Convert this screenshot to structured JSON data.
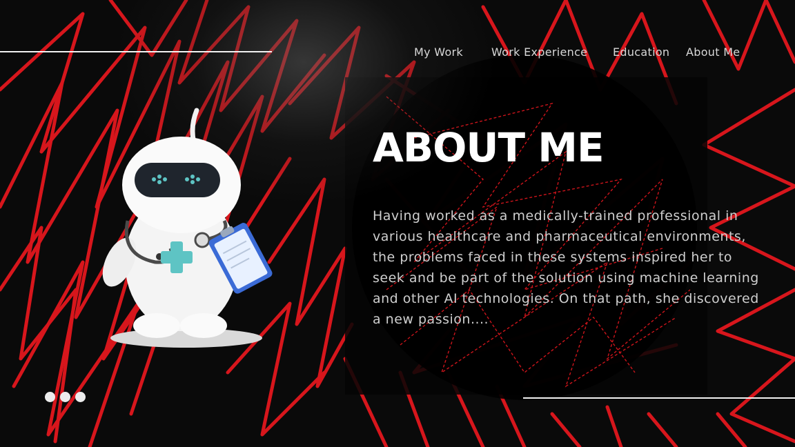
{
  "nav": {
    "items": [
      {
        "label": "My Work"
      },
      {
        "label": "Work Experience"
      },
      {
        "label": "Education"
      },
      {
        "label": "About Me"
      }
    ]
  },
  "hero": {
    "title": "ABOUT ME",
    "body": "Having worked as a medically-trained professional in various healthcare and pharmaceutical environments, the problems faced in these systems inspired her to seek and be part of the solution using machine learning and other AI technologies. On that path, she discovered a new passion...."
  },
  "colors": {
    "accent": "#e3171e",
    "background": "#0a0a0a",
    "robot_accent": "#5ec4c4"
  },
  "illustration": {
    "icon": "doctor-robot-icon"
  },
  "pager": {
    "icon": "more-dots-icon"
  }
}
